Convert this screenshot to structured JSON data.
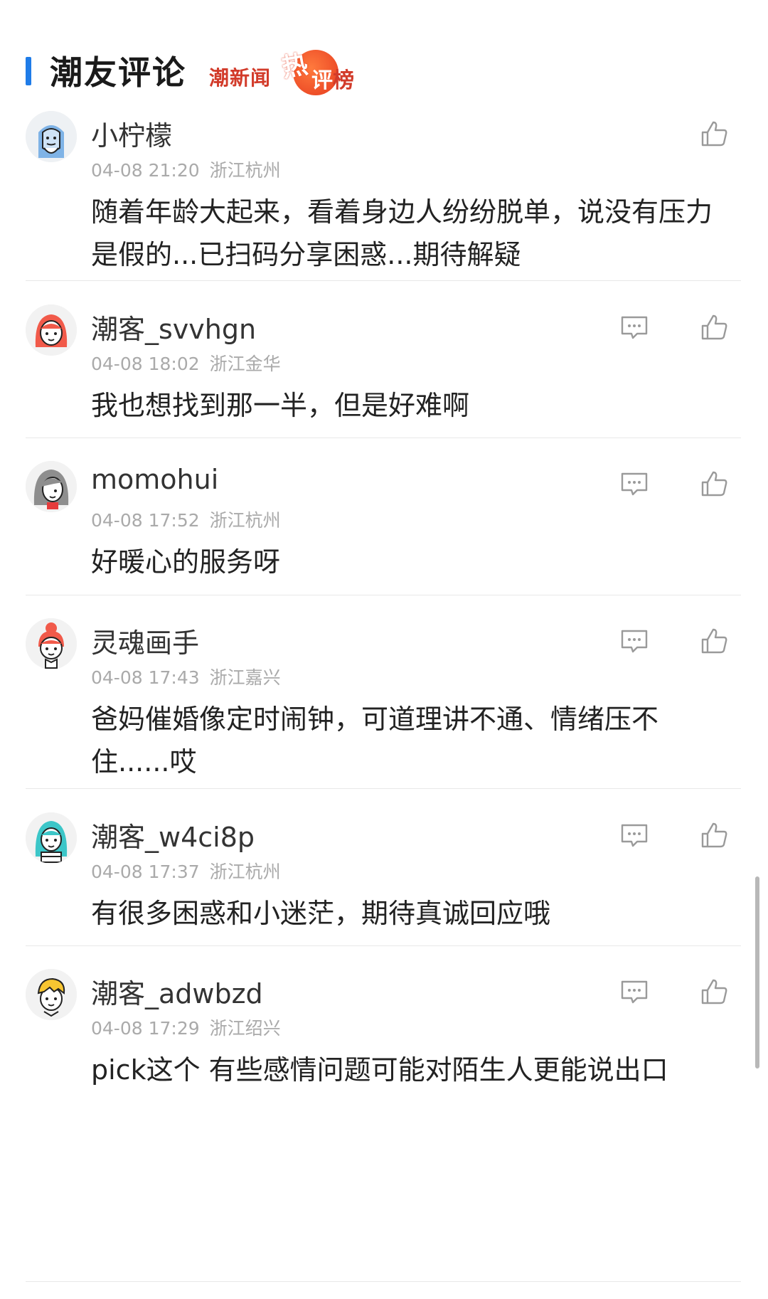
{
  "header": {
    "title": "潮友评论",
    "brand_text_1": "潮新闻",
    "brand_text_hot": "热",
    "brand_text_2_first": "评",
    "brand_text_2_rest": "榜"
  },
  "colors": {
    "accent": "#1f7ce8",
    "brand": "#d23b2a",
    "meta": "#aaaaaa"
  },
  "comments": [
    {
      "name": "小柠檬",
      "time": "04-08 21:20",
      "location": "浙江杭州",
      "content": "随着年龄大起来，看着身边人纷纷脱单，说没有压力是假的...已扫码分享困惑...期待解疑"
    },
    {
      "name": "潮客_svvhgn",
      "time": "04-08 18:02",
      "location": "浙江金华",
      "content": "我也想找到那一半，但是好难啊"
    },
    {
      "name": "momohui",
      "time": "04-08 17:52",
      "location": "浙江杭州",
      "content": "好暖心的服务呀"
    },
    {
      "name": "灵魂画手",
      "time": "04-08 17:43",
      "location": "浙江嘉兴",
      "content": "爸妈催婚像定时闹钟，可道理讲不通、情绪压不住......哎"
    },
    {
      "name": "潮客_w4ci8p",
      "time": "04-08 17:37",
      "location": "浙江杭州",
      "content": "有很多困惑和小迷茫，期待真诚回应哦"
    },
    {
      "name": "潮客_adwbzd",
      "time": "04-08 17:29",
      "location": "浙江绍兴",
      "content": "pick这个 有些感情问题可能对陌生人更能说出口"
    }
  ]
}
